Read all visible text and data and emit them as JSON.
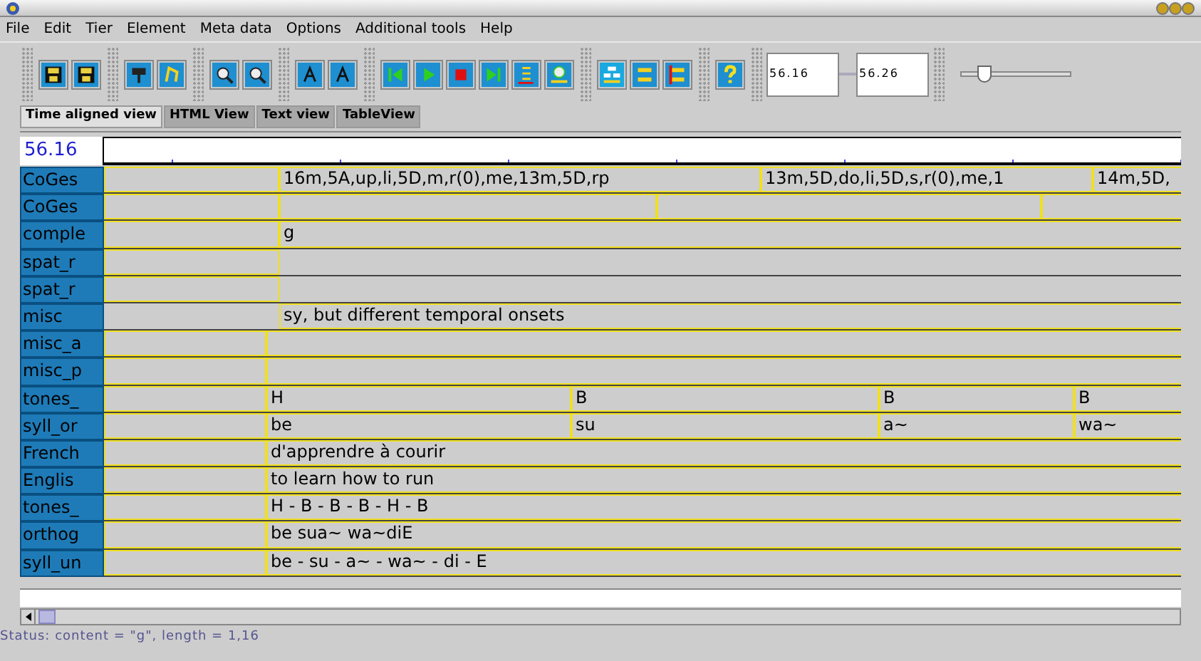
{
  "menu": [
    "File",
    "Edit",
    "Tier",
    "Element",
    "Meta data",
    "Options",
    "Additional tools",
    "Help"
  ],
  "toolbar": {
    "start_time": "56.16",
    "end_time": "56.26",
    "zoom": {
      "level": 0.2
    }
  },
  "tabs": [
    {
      "label": "Time aligned view",
      "selected": true
    },
    {
      "label": "HTML View",
      "selected": false
    },
    {
      "label": "Text view",
      "selected": false
    },
    {
      "label": "TableView",
      "selected": false
    }
  ],
  "ruler": {
    "time": "56.16"
  },
  "tiers": [
    {
      "label": "CoGes",
      "cells": [
        "16m,5A,up,li,5D,m,r(0),me,13m,5D,rp",
        "13m,5D,do,li,5D,s,r(0),me,1",
        "14m,5D,"
      ]
    },
    {
      "label": "CoGes"
    },
    {
      "label": "comple",
      "cells": [
        "g"
      ]
    },
    {
      "label": "spat_r"
    },
    {
      "label": "spat_r"
    },
    {
      "label": "misc",
      "cells": [
        "sy, but different temporal onsets"
      ]
    },
    {
      "label": "misc_a"
    },
    {
      "label": "misc_p"
    },
    {
      "label": "tones_",
      "cells": [
        "H",
        "B",
        "B",
        "B"
      ]
    },
    {
      "label": "syll_or",
      "cells": [
        "be",
        "su",
        "a~",
        "wa~"
      ]
    },
    {
      "label": "French",
      "cells": [
        "d'apprendre à courir"
      ]
    },
    {
      "label": "Englis",
      "cells": [
        "to learn how to run"
      ]
    },
    {
      "label": "tones_",
      "cells": [
        "H - B - B - B - H - B"
      ]
    },
    {
      "label": "orthog",
      "cells": [
        "be sua~ wa~diE"
      ]
    },
    {
      "label": "syll_un",
      "cells": [
        "be - su - a~ - wa~ - di - E"
      ]
    }
  ],
  "status": "Status: content = \"g\", length = 1,16"
}
